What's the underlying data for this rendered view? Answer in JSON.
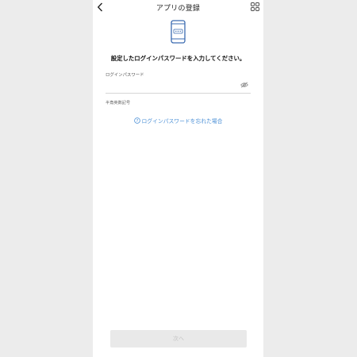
{
  "header": {
    "title": "アプリの登録",
    "back_icon": "chevron-left-icon",
    "scan_icon": "qr-scan-icon"
  },
  "illustration": {
    "icon": "phone-password-icon",
    "color": "#3b6bb0"
  },
  "prompt": "設定したログインパスワードを入力してください。",
  "password_field": {
    "label": "ログインパスワード",
    "value": "",
    "placeholder": "",
    "toggle_icon": "eye-hidden-icon"
  },
  "hint": "半角英数記号",
  "forgot_link": {
    "icon": "help-circle-icon",
    "label": "ログインパスワードを忘れた場合",
    "color": "#4a8fd6"
  },
  "next_button": {
    "label": "次へ",
    "enabled": false
  }
}
